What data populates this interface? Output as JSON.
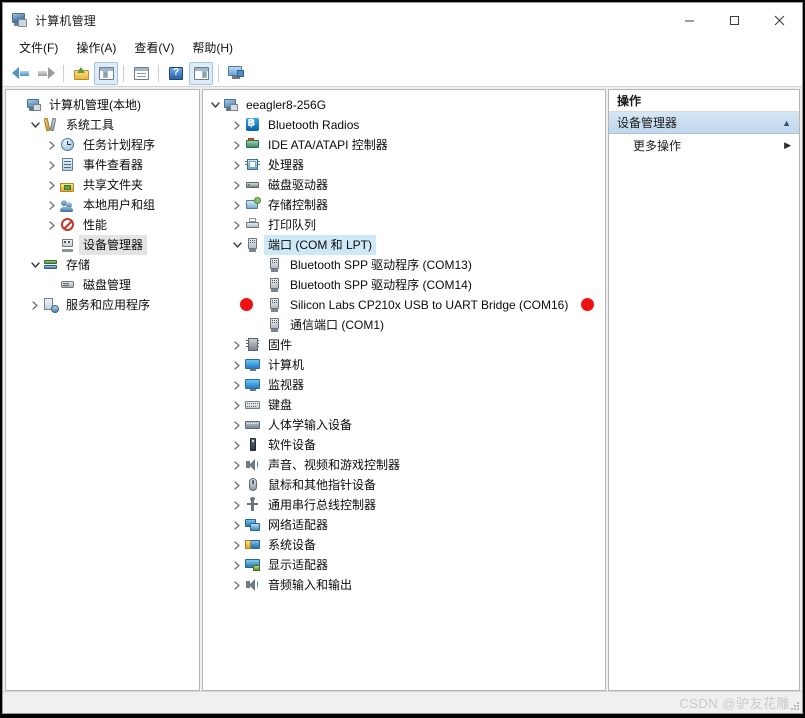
{
  "window": {
    "title": "计算机管理",
    "icon": "computer-management-icon",
    "minimize": "—",
    "maximize": "□",
    "close": "✕"
  },
  "menubar": {
    "items": [
      {
        "label": "文件(F)",
        "name": "menu-file"
      },
      {
        "label": "操作(A)",
        "name": "menu-action"
      },
      {
        "label": "查看(V)",
        "name": "menu-view"
      },
      {
        "label": "帮助(H)",
        "name": "menu-help"
      }
    ]
  },
  "toolbar": {
    "buttons": [
      {
        "name": "back-button",
        "icon": "back-arrow-icon"
      },
      {
        "name": "forward-button",
        "icon": "forward-arrow-icon"
      },
      {
        "name": "up-one-level-button",
        "icon": "folder-up-icon"
      },
      {
        "name": "show-hide-console-tree-button",
        "icon": "console-tree-icon"
      },
      {
        "name": "properties-button",
        "icon": "properties-icon"
      },
      {
        "name": "help-button",
        "icon": "help-question-icon"
      },
      {
        "name": "show-hide-action-pane-button",
        "icon": "action-pane-icon"
      },
      {
        "name": "scan-hardware-changes-button",
        "icon": "scan-monitor-icon"
      }
    ]
  },
  "left_tree": {
    "items": [
      {
        "label": "计算机管理(本地)",
        "icon": "computer-icon",
        "indent": 0,
        "chevron": "none",
        "selected": false
      },
      {
        "label": "系统工具",
        "icon": "tools-icon",
        "indent": 1,
        "chevron": "down",
        "selected": false
      },
      {
        "label": "任务计划程序",
        "icon": "clock-icon",
        "indent": 2,
        "chevron": "right",
        "selected": false
      },
      {
        "label": "事件查看器",
        "icon": "event-viewer-icon",
        "indent": 2,
        "chevron": "right",
        "selected": false
      },
      {
        "label": "共享文件夹",
        "icon": "shared-folder-icon",
        "indent": 2,
        "chevron": "right",
        "selected": false
      },
      {
        "label": "本地用户和组",
        "icon": "users-icon",
        "indent": 2,
        "chevron": "right",
        "selected": false
      },
      {
        "label": "性能",
        "icon": "performance-icon",
        "indent": 2,
        "chevron": "right",
        "selected": false
      },
      {
        "label": "设备管理器",
        "icon": "device-manager-icon",
        "indent": 2,
        "chevron": "none",
        "selected": true
      },
      {
        "label": "存储",
        "icon": "storage-icon",
        "indent": 1,
        "chevron": "down",
        "selected": false
      },
      {
        "label": "磁盘管理",
        "icon": "disk-management-icon",
        "indent": 2,
        "chevron": "none",
        "selected": false
      },
      {
        "label": "服务和应用程序",
        "icon": "services-icon",
        "indent": 1,
        "chevron": "right",
        "selected": false
      }
    ]
  },
  "device_tree": {
    "items": [
      {
        "label": "eeagler8-256G",
        "icon": "computer-node-icon",
        "indent": 0,
        "chevron": "down",
        "selected": false,
        "marker": "none"
      },
      {
        "label": "Bluetooth Radios",
        "icon": "bluetooth-icon",
        "indent": 1,
        "chevron": "right",
        "selected": false,
        "marker": "none"
      },
      {
        "label": "IDE ATA/ATAPI 控制器",
        "icon": "ide-controller-icon",
        "indent": 1,
        "chevron": "right",
        "selected": false,
        "marker": "none"
      },
      {
        "label": "处理器",
        "icon": "processor-icon",
        "indent": 1,
        "chevron": "right",
        "selected": false,
        "marker": "none"
      },
      {
        "label": "磁盘驱动器",
        "icon": "disk-drive-icon",
        "indent": 1,
        "chevron": "right",
        "selected": false,
        "marker": "none"
      },
      {
        "label": "存储控制器",
        "icon": "storage-controller-icon",
        "indent": 1,
        "chevron": "right",
        "selected": false,
        "marker": "none"
      },
      {
        "label": "打印队列",
        "icon": "print-queue-icon",
        "indent": 1,
        "chevron": "right",
        "selected": false,
        "marker": "none"
      },
      {
        "label": "端口 (COM 和 LPT)",
        "icon": "port-icon",
        "indent": 1,
        "chevron": "down",
        "selected": true,
        "marker": "none"
      },
      {
        "label": "Bluetooth SPP 驱动程序 (COM13)",
        "icon": "port-icon",
        "indent": 2,
        "chevron": "none",
        "selected": false,
        "marker": "none"
      },
      {
        "label": "Bluetooth SPP 驱动程序 (COM14)",
        "icon": "port-icon",
        "indent": 2,
        "chevron": "none",
        "selected": false,
        "marker": "none"
      },
      {
        "label": "Silicon Labs CP210x USB to UART Bridge (COM16)",
        "icon": "port-icon",
        "indent": 2,
        "chevron": "none",
        "selected": false,
        "marker": "both"
      },
      {
        "label": "通信端口 (COM1)",
        "icon": "port-icon",
        "indent": 2,
        "chevron": "none",
        "selected": false,
        "marker": "none"
      },
      {
        "label": "固件",
        "icon": "firmware-icon",
        "indent": 1,
        "chevron": "right",
        "selected": false,
        "marker": "none"
      },
      {
        "label": "计算机",
        "icon": "computer-category-icon",
        "indent": 1,
        "chevron": "right",
        "selected": false,
        "marker": "none"
      },
      {
        "label": "监视器",
        "icon": "monitor-icon",
        "indent": 1,
        "chevron": "right",
        "selected": false,
        "marker": "none"
      },
      {
        "label": "键盘",
        "icon": "keyboard-icon",
        "indent": 1,
        "chevron": "right",
        "selected": false,
        "marker": "none"
      },
      {
        "label": "人体学输入设备",
        "icon": "hid-icon",
        "indent": 1,
        "chevron": "right",
        "selected": false,
        "marker": "none"
      },
      {
        "label": "软件设备",
        "icon": "software-device-icon",
        "indent": 1,
        "chevron": "right",
        "selected": false,
        "marker": "none"
      },
      {
        "label": "声音、视频和游戏控制器",
        "icon": "sound-video-game-icon",
        "indent": 1,
        "chevron": "right",
        "selected": false,
        "marker": "none"
      },
      {
        "label": "鼠标和其他指针设备",
        "icon": "mouse-icon",
        "indent": 1,
        "chevron": "right",
        "selected": false,
        "marker": "none"
      },
      {
        "label": "通用串行总线控制器",
        "icon": "usb-controller-icon",
        "indent": 1,
        "chevron": "right",
        "selected": false,
        "marker": "none"
      },
      {
        "label": "网络适配器",
        "icon": "network-adapter-icon",
        "indent": 1,
        "chevron": "right",
        "selected": false,
        "marker": "none"
      },
      {
        "label": "系统设备",
        "icon": "system-device-icon",
        "indent": 1,
        "chevron": "right",
        "selected": false,
        "marker": "none"
      },
      {
        "label": "显示适配器",
        "icon": "display-adapter-icon",
        "indent": 1,
        "chevron": "right",
        "selected": false,
        "marker": "none"
      },
      {
        "label": "音频输入和输出",
        "icon": "audio-io-icon",
        "indent": 1,
        "chevron": "right",
        "selected": false,
        "marker": "none"
      }
    ]
  },
  "actions_pane": {
    "header": "操作",
    "group_title": "设备管理器",
    "group_caret": "collapse-caret-icon",
    "rows": [
      {
        "label": "更多操作",
        "caret": "submenu-caret-icon"
      }
    ]
  },
  "statusbar": {
    "watermark": "CSDN @驴友花雕"
  },
  "colors": {
    "selection_blue": "#cde8f7",
    "selection_gray": "#e4e4e4",
    "marker_red": "#ee1111",
    "actions_group_bg": "#cfe2f2"
  }
}
